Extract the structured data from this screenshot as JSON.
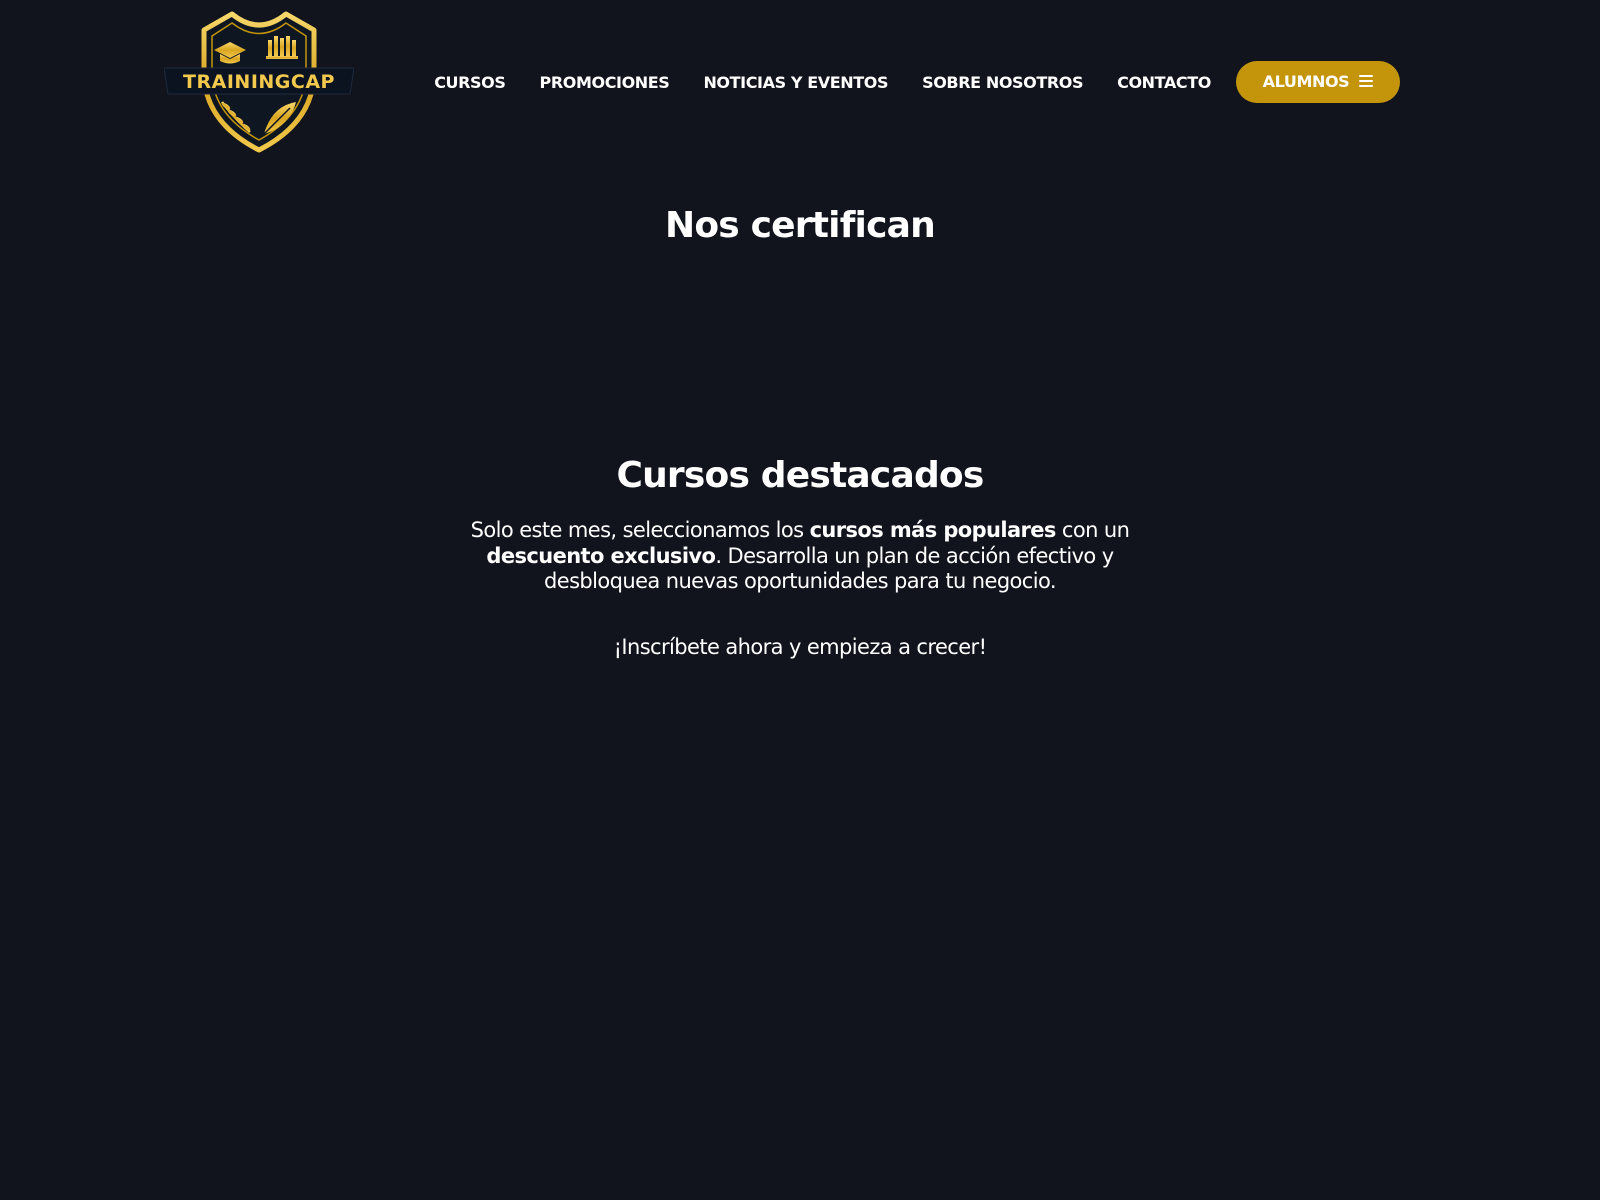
{
  "brand": {
    "logo_text": "TRAININGCAP",
    "gold": "#c4950a",
    "gold_light": "#f2c94c",
    "background": "#11131d"
  },
  "nav": {
    "items": [
      {
        "label": "CURSOS"
      },
      {
        "label": "PROMOCIONES"
      },
      {
        "label": "NOTICIAS Y EVENTOS"
      },
      {
        "label": "SOBRE NOSOTROS"
      },
      {
        "label": "CONTACTO"
      }
    ],
    "students_label": "ALUMNOS",
    "students_icon": "menu-icon"
  },
  "certify": {
    "title": "Nos certifican"
  },
  "featured": {
    "title": "Cursos destacados",
    "intro_part1": "Solo este mes, seleccionamos los ",
    "intro_bold1": "cursos más populares",
    "intro_part2": " con un ",
    "intro_bold2": "descuento exclusivo",
    "intro_part3": ". Desarrolla un plan de acción efectivo y desbloquea nuevas oportunidades para tu negocio.",
    "cta": "¡Inscríbete ahora y empieza a crecer!"
  }
}
